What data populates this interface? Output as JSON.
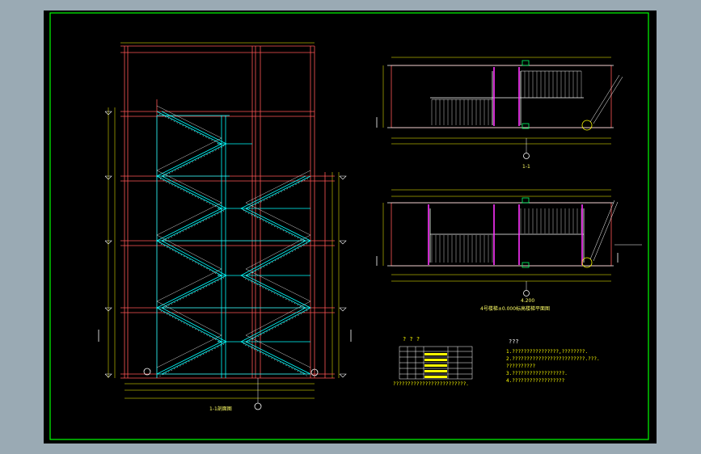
{
  "elevation": {
    "title": "1-1剖面图"
  },
  "section": {
    "label": "1-1"
  },
  "plan": {
    "label": "4.200",
    "title": "4号楼梯±0.000标高楼梯平面图"
  },
  "schedule": {
    "title": "? ? ?",
    "columns": [
      "?",
      "?",
      "?",
      "?",
      "?",
      "?"
    ],
    "rows": 6,
    "footer": "?????????????????????????."
  },
  "notes": {
    "title": "???",
    "lines": [
      "1.????????????????,????????.",
      "2.?????????????????????????.???.",
      "  ??????????",
      "3.??????????????????.",
      "4.??????????????????"
    ]
  },
  "colors": {
    "background": "#000000",
    "frame": "#00ff00",
    "structure": "#ff5555",
    "stairs": "#00ffff",
    "dimension": "#ffff00",
    "section_mark": "#ff33ff",
    "text": "#ffffff"
  }
}
